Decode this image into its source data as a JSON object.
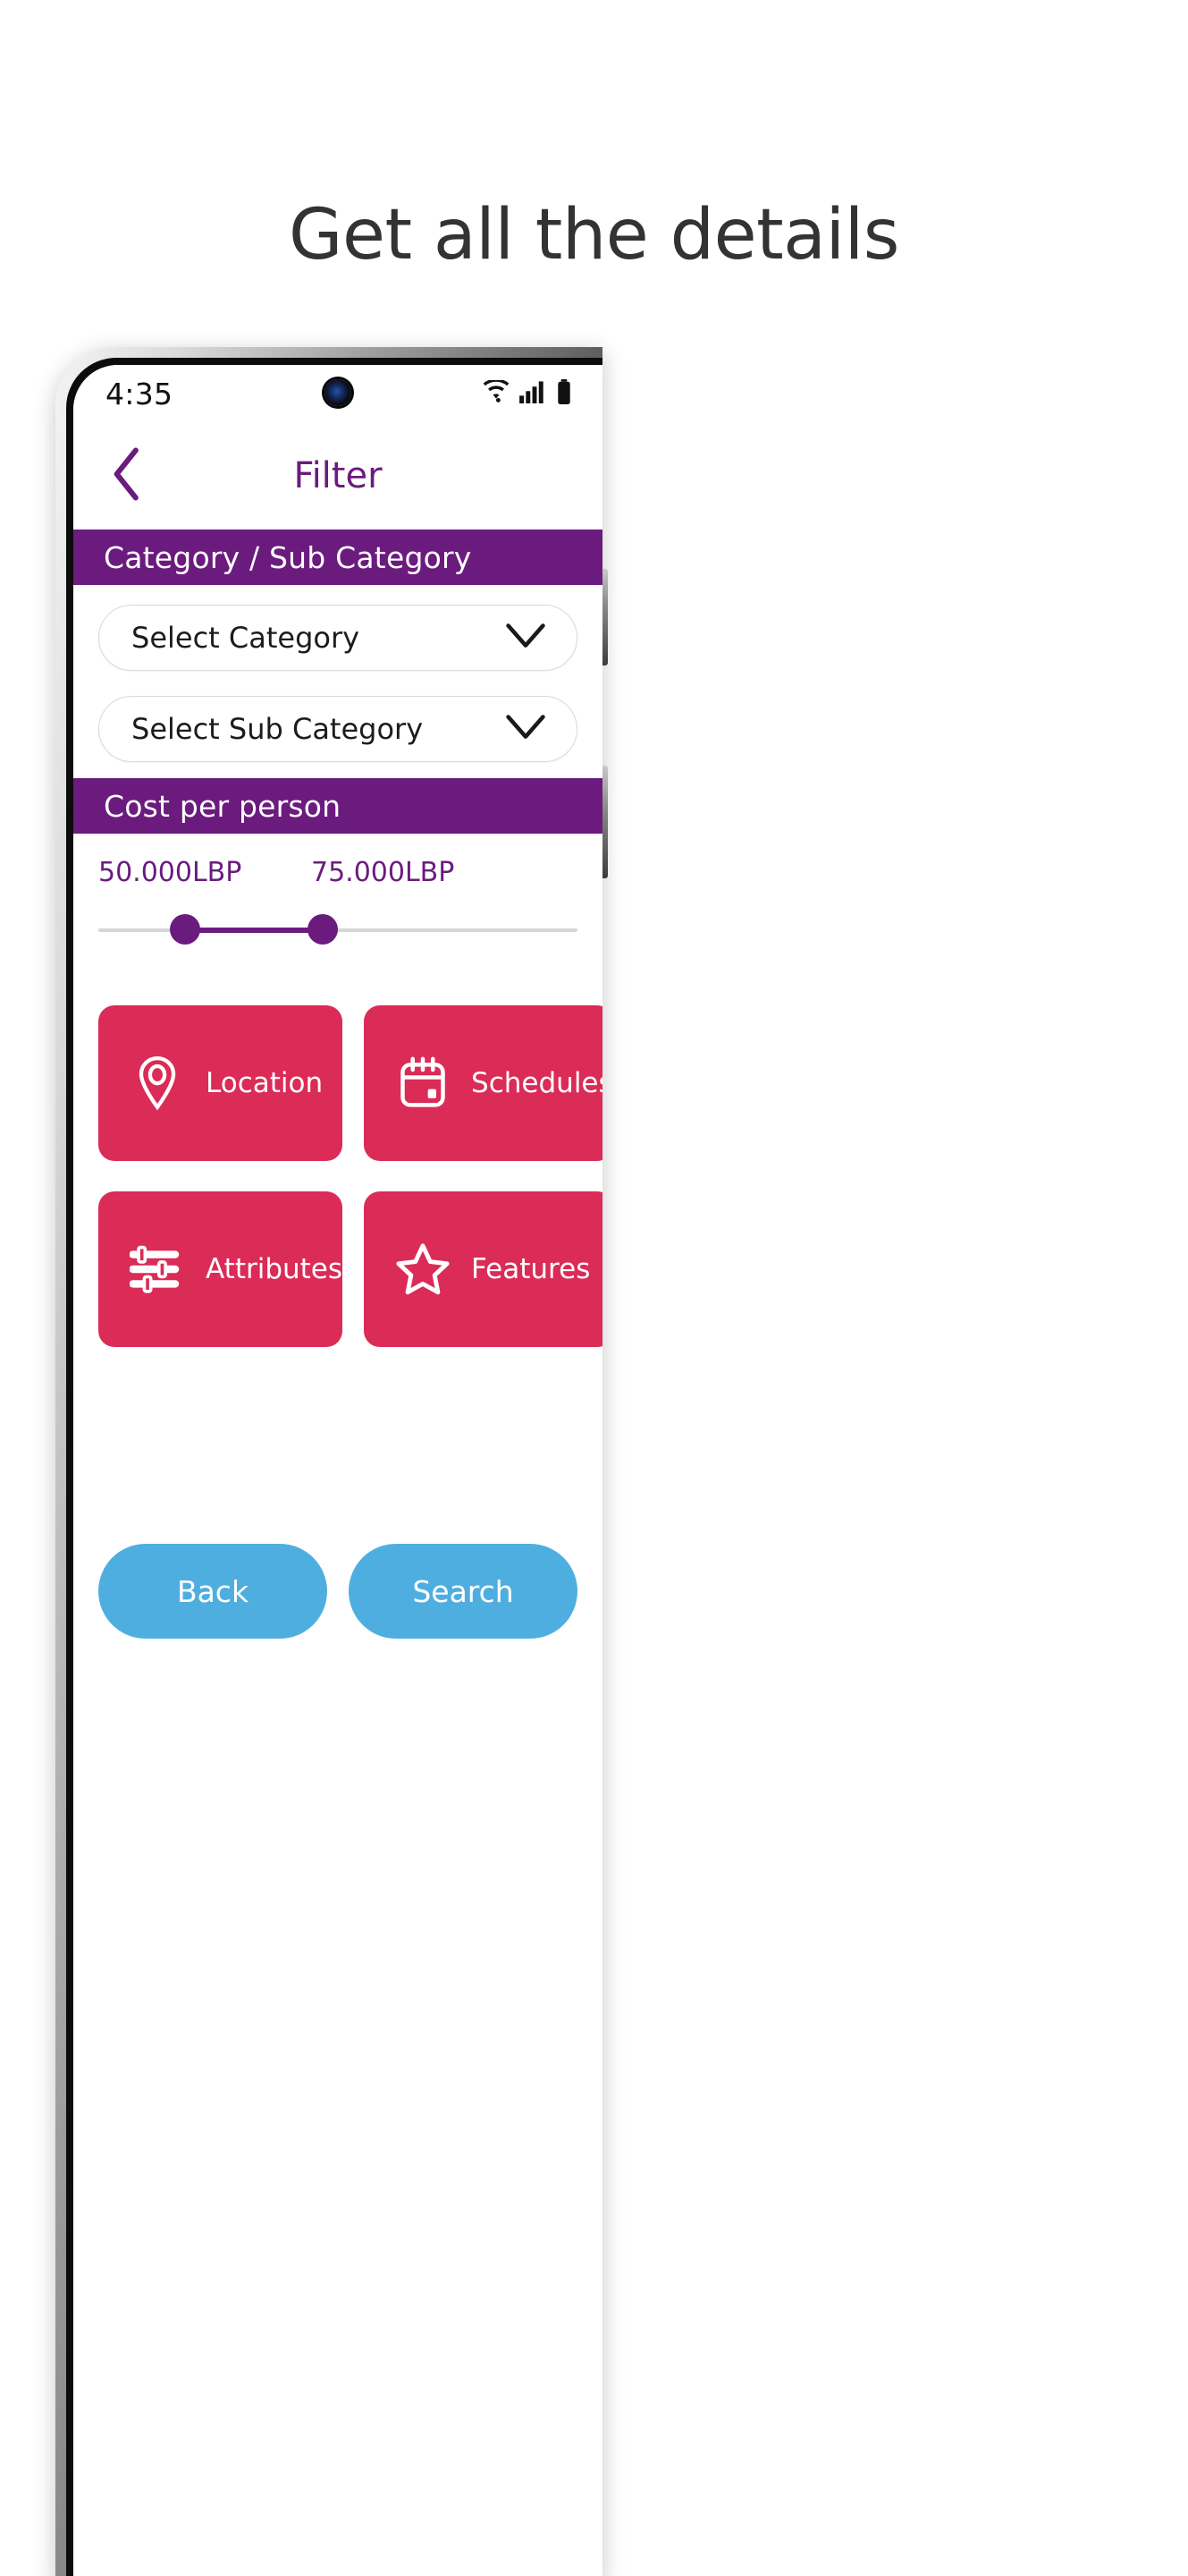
{
  "headline": "Get all the details",
  "phone": {
    "status_bar": {
      "time": "4:35",
      "icons": [
        "wifi-icon",
        "cellular-signal-icon",
        "battery-icon"
      ]
    },
    "header": {
      "back_icon": "chevron-left-icon",
      "title": "Filter"
    },
    "sections": [
      {
        "id": "category",
        "bar_title": "Category / Sub Category"
      },
      {
        "id": "cost",
        "bar_title": "Cost per person"
      }
    ],
    "dropdowns": [
      {
        "label": "Select Category",
        "icon": "chevron-down-icon"
      },
      {
        "label": "Select Sub Category",
        "icon": "chevron-down-icon"
      }
    ],
    "cost_slider": {
      "min_label": "50.000LBP",
      "max_label": "75.000LBP",
      "min_value": 50000,
      "max_value": 75000,
      "currency": "LBP"
    },
    "tiles": [
      {
        "label": "Location",
        "icon": "map-pin-icon"
      },
      {
        "label": "Schedules",
        "icon": "calendar-icon"
      },
      {
        "label": "Attributes",
        "icon": "sliders-icon"
      },
      {
        "label": "Features",
        "icon": "star-icon"
      }
    ],
    "actions": [
      {
        "label": "Back"
      },
      {
        "label": "Search"
      }
    ]
  },
  "colors": {
    "purple": "#6B1B7E",
    "crimson": "#DB2B57",
    "blue": "#4FAEE0",
    "headline_text": "#333333"
  }
}
